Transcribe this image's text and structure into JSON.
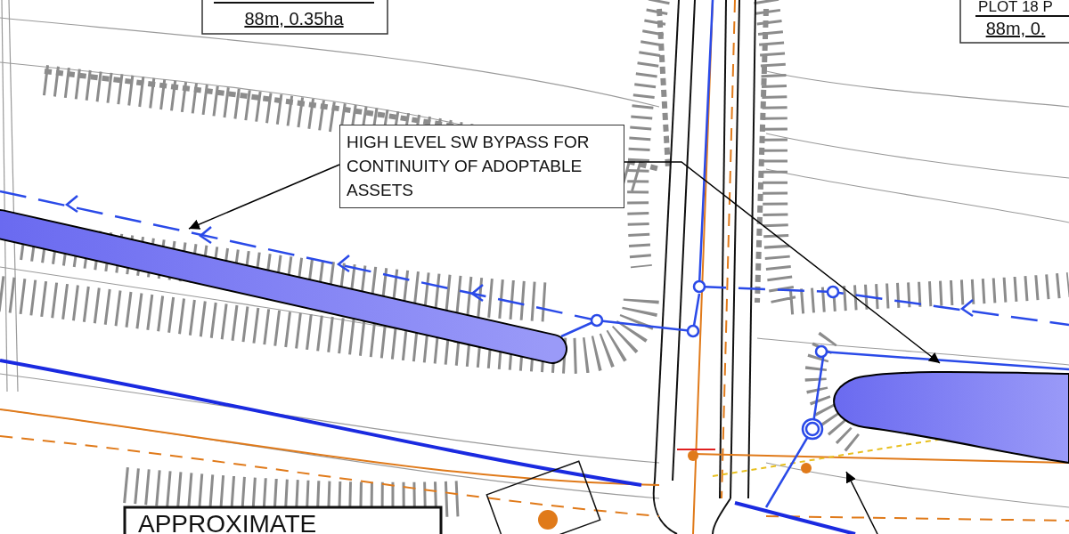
{
  "plot_labels": [
    {
      "lines": [
        "88m, 0.35ha"
      ]
    },
    {
      "lines": [
        "PLOT 18 P",
        "88m, 0."
      ]
    }
  ],
  "callout": {
    "lines": [
      "HIGH LEVEL SW BYPASS FOR",
      "CONTINUITY OF ADOPTABLE",
      "ASSETS"
    ]
  },
  "title_box": {
    "text": "APPROXIMATE"
  }
}
